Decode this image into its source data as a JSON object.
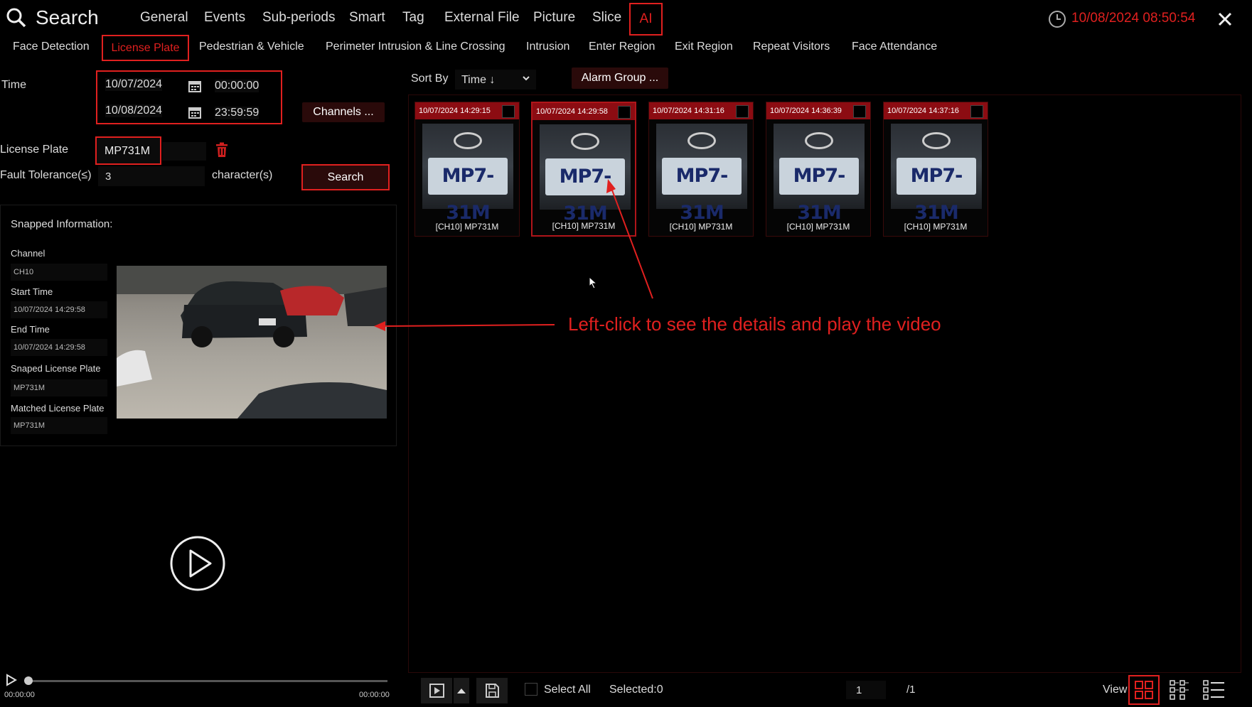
{
  "header": {
    "title": "Search",
    "nav": [
      "General",
      "Events",
      "Sub-periods",
      "Smart",
      "Tag",
      "External File",
      "Picture",
      "Slice",
      "AI"
    ],
    "datetime": "10/08/2024 08:50:54"
  },
  "subnav": [
    "Face Detection",
    "License Plate",
    "Pedestrian & Vehicle",
    "Perimeter Intrusion & Line Crossing",
    "Intrusion",
    "Enter Region",
    "Exit Region",
    "Repeat Visitors",
    "Face Attendance"
  ],
  "filters": {
    "time_label": "Time",
    "start_date": "10/07/2024",
    "start_time": "00:00:00",
    "end_date": "10/08/2024",
    "end_time": "23:59:59",
    "channels_button": "Channels ...",
    "plate_label": "License Plate",
    "plate_value": "MP731M",
    "tolerance_label": "Fault Tolerance(≤)",
    "tolerance_value": "3",
    "tolerance_unit": "character(s)",
    "search_button": "Search"
  },
  "snapped": {
    "title": "Snapped Information:",
    "channel_label": "Channel",
    "channel_value": "CH10",
    "start_label": "Start Time",
    "start_value": "10/07/2024 14:29:58",
    "end_label": "End Time",
    "end_value": "10/07/2024 14:29:58",
    "snaped_label": "Snaped License Plate",
    "snaped_value": "MP731M",
    "matched_label": "Matched License Plate",
    "matched_value": "MP731M"
  },
  "player": {
    "time_start": "00:00:00",
    "time_end": "00:00:00",
    "progress": 0
  },
  "results_toolbar": {
    "sort_label": "Sort By",
    "sort_value": "Time ↓",
    "alarm_group": "Alarm Group ..."
  },
  "results": [
    {
      "time": "10/07/2024 14:29:15",
      "plate_text": "MP7-31M",
      "caption": "[CH10] MP731M"
    },
    {
      "time": "10/07/2024 14:29:58",
      "plate_text": "MP7-31M",
      "caption": "[CH10] MP731M"
    },
    {
      "time": "10/07/2024 14:31:16",
      "plate_text": "MP7-31M",
      "caption": "[CH10] MP731M"
    },
    {
      "time": "10/07/2024 14:36:39",
      "plate_text": "MP7-31M",
      "caption": "[CH10] MP731M"
    },
    {
      "time": "10/07/2024 14:37:16",
      "plate_text": "MP7-31M",
      "caption": "[CH10] MP731M"
    }
  ],
  "annotation": "Left-click to see the details and play the video",
  "footer": {
    "select_all": "Select All",
    "selected": "Selected:0",
    "page": "1",
    "page_total": "/1",
    "view_label": "View"
  },
  "colors": {
    "accent": "#e0201f",
    "background": "#000000"
  }
}
